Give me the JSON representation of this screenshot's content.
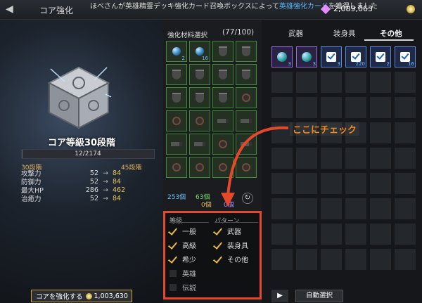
{
  "header": {
    "title": "コア強化",
    "ticker_pre": "ほべさんが英雄精霊デッキ強化カード召喚ボックスによって",
    "ticker_item": "英雄強化カード",
    "ticker_post": "を獲得しました",
    "gold": "2,089,063"
  },
  "core": {
    "level_label": "コア等級30段階",
    "xp_text": "12/2174",
    "xp_fraction": 0.006,
    "stage_current": "30段階",
    "stage_next": "45段階",
    "stats": [
      {
        "name": "攻撃力",
        "from": "52",
        "arrow": "→",
        "to": "84"
      },
      {
        "name": "防御力",
        "from": "52",
        "arrow": "→",
        "to": "84"
      },
      {
        "name": "最大HP",
        "from": "286",
        "arrow": "→",
        "to": "462"
      },
      {
        "name": "治癒力",
        "from": "52",
        "arrow": "→",
        "to": "84"
      }
    ],
    "enhance_label": "コアを強化する",
    "enhance_cost": "1,003,630"
  },
  "materials": {
    "header": "強化材料選択",
    "count": "(77/100)",
    "qty_1": "2",
    "qty_2": "16",
    "count_blue": "253個",
    "count_green": "63個",
    "count_green_sub": "0個",
    "count_purple": "0個"
  },
  "filter": {
    "grade_header": "等級",
    "pattern_header": "パターン",
    "grades": [
      {
        "label": "一般",
        "checked": true
      },
      {
        "label": "高級",
        "checked": true
      },
      {
        "label": "希少",
        "checked": true
      },
      {
        "label": "英雄",
        "checked": false
      },
      {
        "label": "伝説",
        "checked": false
      }
    ],
    "patterns": [
      {
        "label": "武器",
        "checked": true
      },
      {
        "label": "装身具",
        "checked": true
      },
      {
        "label": "その他",
        "checked": true
      }
    ]
  },
  "right": {
    "tabs": [
      "武器",
      "装身具",
      "その他"
    ],
    "active_tab": "その他",
    "slot_qty": [
      "3",
      "3",
      "3",
      "220",
      "2",
      "16"
    ],
    "annotation": "ここにチェック",
    "auto_select": "自動選択",
    "play": "▶"
  },
  "colors": {
    "accent_red": "#e5492b",
    "annotation": "#f08a1b",
    "check": "#e8b548"
  }
}
